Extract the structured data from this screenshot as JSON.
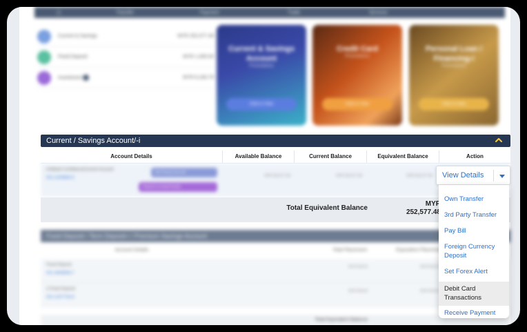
{
  "top_nav": {
    "items": [
      "Transfer",
      "Payment",
      "Trade",
      "Services",
      ""
    ]
  },
  "summary": {
    "rows": [
      {
        "label": "Current & Savings",
        "value": "MYR 252,577.48",
        "color": "#7aa0e0"
      },
      {
        "label": "Fixed Deposit",
        "value": "MYR 1,000.00",
        "color": "#5ac0a0"
      },
      {
        "label": "Investment",
        "value": "MYR 8,183.78",
        "color": "#9a6ad8"
      }
    ]
  },
  "promos": [
    {
      "title": "Current & Savings Account",
      "subtitle": "Promotions",
      "button": "Click to View"
    },
    {
      "title": "Credit Card",
      "subtitle": "Promotions",
      "button": "Click to View"
    },
    {
      "title": "Personal Loan / Financing-i",
      "subtitle": "Promotions",
      "button": "Click to View"
    }
  ],
  "current_savings": {
    "title": "Current / Savings Account/-i",
    "columns": [
      "Account Details",
      "Available Balance",
      "Current Balance",
      "Equivalent Balance",
      "Action"
    ],
    "account": {
      "name": "AmBank ConfidenceCurrent Account",
      "number": "001-2209684-5",
      "badge_primary": "My Primary Account",
      "badge_secondary": "Request overdraft facility",
      "available": "MYR 252,577.48",
      "current": "MYR 252,577.48",
      "equivalent": "MYR 252,577.48"
    },
    "total_label": "Total Equivalent Balance",
    "total_currency": "MYR",
    "total_value": "252,577.48"
  },
  "action": {
    "button_label": "View Details",
    "menu": [
      "Own Transfer",
      "3rd Party Transfer",
      "Pay Bill",
      "Foreign Currency Deposit",
      "Set Forex Alert",
      "Debit Card Transactions",
      "Receive Payment"
    ],
    "highlighted": "Debit Card Transactions"
  },
  "fixed_deposit": {
    "title": "Fixed Deposit / Term Deposit-i / Premium Savings Account",
    "columns": [
      "Account Details",
      "Total Placement",
      "Equivalent Placement"
    ],
    "rows": [
      {
        "name": "Fixed Deposit",
        "number": "001-4649808-7",
        "placement": "MYR 500.00",
        "equivalent": "MYR 500.00"
      },
      {
        "name": "e-Fixed Deposit",
        "number": "001-2207734-8",
        "placement": "MYR 500.00",
        "equivalent": "MYR 500.00"
      }
    ],
    "total_label": "Total Equivalent Balance"
  },
  "colors": {
    "navy": "#263754",
    "link_blue": "#2f6fc9",
    "chevron_yellow": "#f3c53c"
  }
}
